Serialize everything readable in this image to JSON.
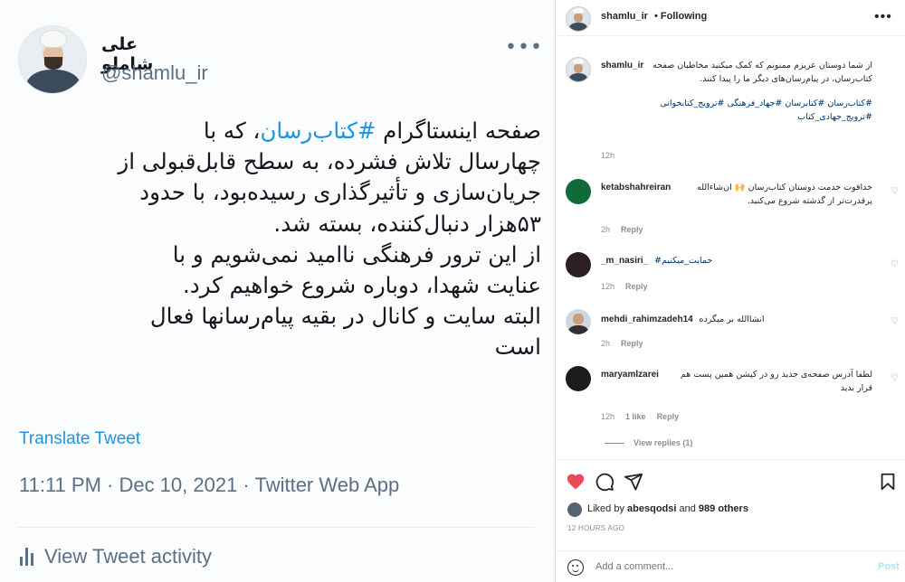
{
  "tweet": {
    "name": "علی شاملو",
    "handle": "@shamlu_ir",
    "more": "•••",
    "text_lines": [
      {
        "before": "صفحه اینستاگرام ",
        "highlight": "#کتاب‌رسان",
        "after": "، که با"
      },
      {
        "before": "چهارسال تلاش فشرده، به سطح قابل‌قبولی از",
        "highlight": "",
        "after": ""
      },
      {
        "before": "جریان‌سازی و تأثیرگذاری رسیده‌بود، با حدود",
        "highlight": "",
        "after": ""
      },
      {
        "before": "۵۳هزار دنبال‌کننده، بسته شد.",
        "highlight": "",
        "after": ""
      },
      {
        "before": "از این ترور فرهنگی ناامید نمی‌شویم و با",
        "highlight": "",
        "after": ""
      },
      {
        "before": "عنایت شهدا، دوباره شروع خواهیم کرد.",
        "highlight": "",
        "after": ""
      },
      {
        "before": "البته سایت و کانال در بقیه پیام‌رسانها فعال",
        "highlight": "",
        "after": ""
      },
      {
        "before": "است",
        "highlight": "",
        "after": ""
      }
    ],
    "translate": "Translate Tweet",
    "meta": "11:11 PM · Dec 10, 2021 · Twitter Web App",
    "activity": "View Tweet activity",
    "link_color": "#1b95e0"
  },
  "instagram": {
    "header": {
      "username": "shamlu_ir",
      "separator": "•",
      "follow_status": "Following",
      "more": "•••"
    },
    "caption": {
      "username": "shamlu_ir",
      "text": "از شما دوستان عزیزم ممنونم که کمک میکنید مخاطبان صفحه کتاب‌رسان، در پیام‌رسان‌های دیگر ما را پیدا کنند.",
      "hashtags": "#کتاب‌رسان #کتابرسان #جهاد_فرهنگی #ترویج_کتابخوانی #ترویج_جهادی_کتاب",
      "time": "12h"
    },
    "comments": [
      {
        "username": "ketabshahreiran",
        "text": "خداقوت خدمت دوستان کتاب‌رسان 🙌 ان‌شاءالله پرقدرت‌تر از گذشته شروع می‌کنید.",
        "time": "2h",
        "likes": "",
        "reply": "Reply"
      },
      {
        "username": "_m_nasiri_",
        "text": "#حمایت_میکنیم",
        "time": "12h",
        "likes": "",
        "reply": "Reply"
      },
      {
        "username": "mehdi_rahimzadeh14",
        "text": "انشاالله بر میگرده",
        "time": "2h",
        "likes": "",
        "reply": "Reply"
      },
      {
        "username": "maryamlzarei",
        "text": "لطفا آدرس صفحه‌ی جدید رو در کپشن همین پست هم قرار بدید",
        "time": "12h",
        "likes": "1 like",
        "reply": "Reply"
      }
    ],
    "view_replies": "View replies (1)",
    "likes": {
      "prefix": "Liked by ",
      "user": "abesqodsi",
      "middle": " and ",
      "others": "989 others"
    },
    "timestamp": "12 HOURS AGO",
    "add_comment": {
      "placeholder": "Add a comment...",
      "post": "Post"
    },
    "colors": {
      "heart": "#ed4956",
      "border": "#dbdbdb",
      "muted": "#8e8e8e",
      "hashtag": "#00376b"
    }
  }
}
